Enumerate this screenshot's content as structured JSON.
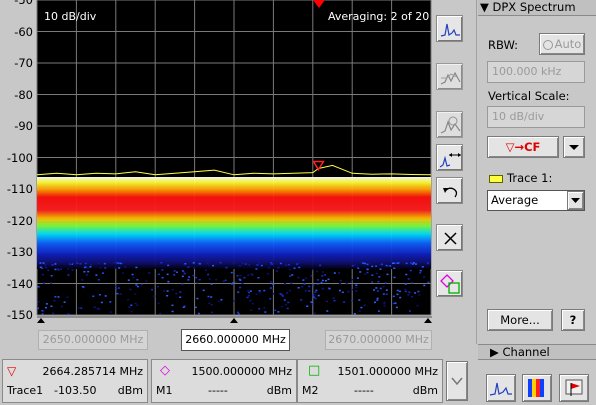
{
  "display": {
    "scale_label": "10 dB/div",
    "averaging_label": "Averaging: 2 of 20"
  },
  "freq": {
    "start": "2650.000000 MHz",
    "center": "2660.000000 MHz",
    "stop": "2670.000000 MHz"
  },
  "chart_data": {
    "type": "line",
    "title": "",
    "ytick_labels": [
      "-50",
      "-60",
      "-70",
      "-80",
      "-90",
      "-100",
      "-110",
      "-120",
      "-130",
      "-140",
      "-150"
    ],
    "ylim": [
      -150,
      -50
    ],
    "xlim": [
      2650,
      2670
    ],
    "grid": true,
    "series": [
      {
        "name": "Trace 1",
        "x": [
          2650,
          2651,
          2652,
          2653,
          2654,
          2655,
          2656,
          2657,
          2658,
          2659,
          2660,
          2661,
          2662,
          2663,
          2664,
          2664.29,
          2665,
          2666,
          2667,
          2668,
          2669,
          2670
        ],
        "y": [
          -105.5,
          -105,
          -105.5,
          -105,
          -105.2,
          -104.5,
          -105.5,
          -105,
          -104.5,
          -104,
          -105.5,
          -105,
          -105.2,
          -105,
          -104.8,
          -103.5,
          -102.5,
          -105,
          -105.3,
          -105.2,
          -105.4,
          -105.5
        ]
      }
    ],
    "marker": {
      "x": 2664.285714,
      "y": -103.5,
      "label": "1"
    }
  },
  "sidebar_icons": [
    "spectrum-view-icon",
    "persistence-icon",
    "settings-view-icon",
    "zoom-span-icon",
    "undo-icon",
    "close-icon",
    "marker-toggle-icon"
  ],
  "panel": {
    "header": "▼ DPX Spectrum",
    "rbw_label": "RBW:",
    "auto_label": "Auto",
    "rbw_value": "100.000 kHz",
    "vscale_label": "Vertical Scale:",
    "vscale_value": "10 dB/div",
    "to_cf_label": "▽→CF",
    "trace_label": "Trace 1:",
    "trace_mode": "Average",
    "more_label": "More...",
    "help_label": "?",
    "channel_label": "▶ Channel"
  },
  "markers": [
    {
      "symbol": "▽",
      "color": "#e00000",
      "freq": "2664.285714 MHz",
      "name": "Trace1",
      "level": "-103.50",
      "unit": "dBm"
    },
    {
      "symbol": "◇",
      "color": "#e000e0",
      "freq": "1500.000000 MHz",
      "name": "M1",
      "level": "-----",
      "unit": "dBm"
    },
    {
      "symbol": "□",
      "color": "#00b000",
      "freq": "1501.000000 MHz",
      "name": "M2",
      "level": "-----",
      "unit": "dBm"
    }
  ],
  "colors": {
    "trace": "#ffff40",
    "marker": "#ff2020",
    "plot_bg": "#000000",
    "grid": "#7a7a7a"
  }
}
